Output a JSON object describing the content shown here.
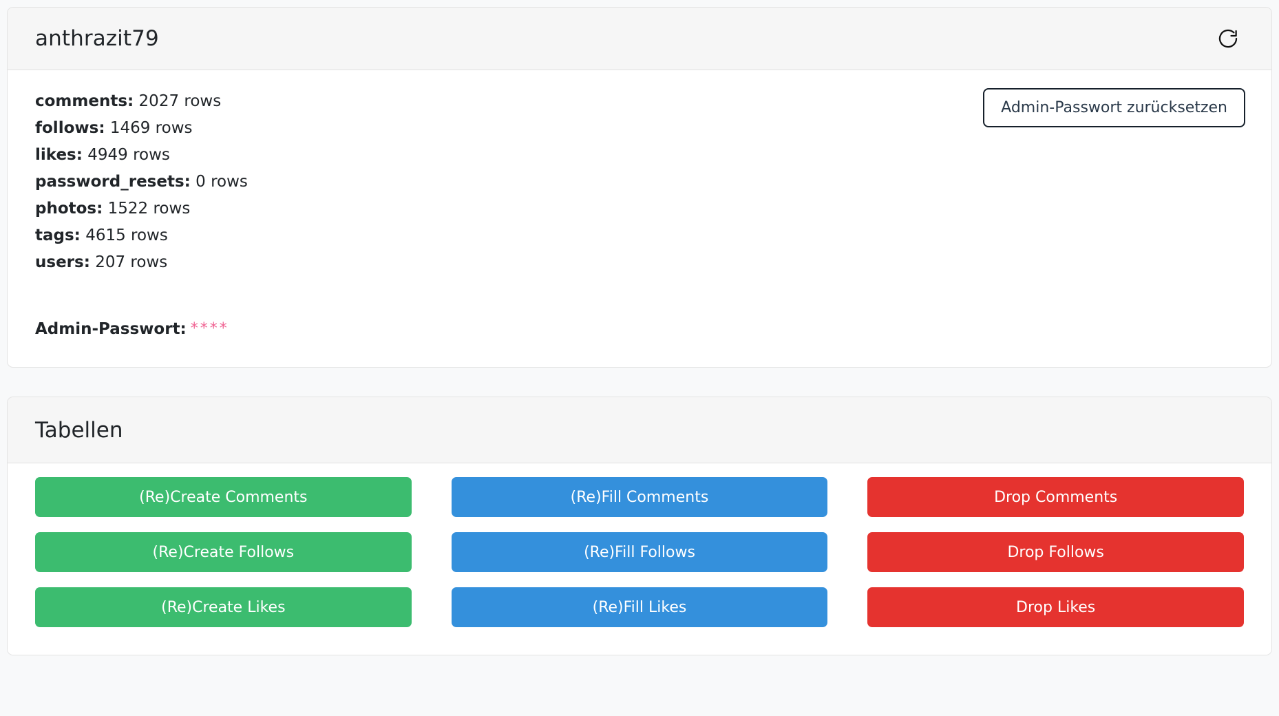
{
  "status_card": {
    "title": "anthrazit79",
    "refresh_icon": "refresh-icon",
    "stats": [
      {
        "name": "comments:",
        "value": "2027 rows"
      },
      {
        "name": "follows:",
        "value": "1469 rows"
      },
      {
        "name": "likes:",
        "value": "4949 rows"
      },
      {
        "name": "password_resets:",
        "value": "0 rows"
      },
      {
        "name": "photos:",
        "value": "1522 rows"
      },
      {
        "name": "tags:",
        "value": "4615 rows"
      },
      {
        "name": "users:",
        "value": "207 rows"
      }
    ],
    "password": {
      "label": "Admin-Passwort:",
      "value": "****",
      "value_color": "#f06292"
    },
    "reset_button_label": "Admin-Passwort zurücksetzen"
  },
  "tables_card": {
    "title": "Tabellen",
    "colors": {
      "create": "#3cbc6f",
      "fill": "#3490dc",
      "drop": "#e5332f"
    },
    "rows": [
      {
        "create_label": "(Re)Create Comments",
        "fill_label": "(Re)Fill Comments",
        "drop_label": "Drop Comments"
      },
      {
        "create_label": "(Re)Create Follows",
        "fill_label": "(Re)Fill Follows",
        "drop_label": "Drop Follows"
      },
      {
        "create_label": "(Re)Create Likes",
        "fill_label": "(Re)Fill Likes",
        "drop_label": "Drop Likes"
      }
    ]
  }
}
